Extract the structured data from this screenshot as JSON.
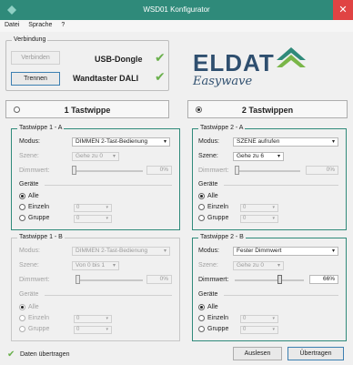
{
  "window": {
    "title": "WSD01 Konfigurator",
    "close_glyph": "✕",
    "app_icon": "diamond-icon",
    "accent": "#2f8a7a"
  },
  "menu": [
    "Datei",
    "Sprache",
    "?"
  ],
  "connection": {
    "legend": "Verbindung",
    "connect_label": "Verbinden",
    "disconnect_label": "Trennen",
    "usb_label": "USB-Dongle",
    "dali_label": "Wandtaster DALI",
    "usb_ok": "✔",
    "dali_ok": "✔"
  },
  "logo": {
    "brand": "ELDAT",
    "sub": "Easywave"
  },
  "mode_tabs": [
    {
      "label": "1 Tastwippe",
      "selected": false
    },
    {
      "label": "2 Tastwippen",
      "selected": true
    }
  ],
  "panels": [
    {
      "legend": "Tastwippe 1 - A",
      "modus_label": "Modus:",
      "modus_value": "DIMMEN 2-Tast-Bedienung",
      "szene_label": "Szene:",
      "szene_value": "Gehe zu 0",
      "dimm_label": "Dimmwert:",
      "dimm_value": "0%",
      "dimm_fraction": 0.0,
      "geraete_label": "Geräte",
      "alle_label": "Alle",
      "einzeln_label": "Einzeln",
      "einzeln_value": "0",
      "gruppe_label": "Gruppe",
      "gruppe_value": "0"
    },
    {
      "legend": "Tastwippe 2 - A",
      "modus_label": "Modus:",
      "modus_value": "SZENE aufrufen",
      "szene_label": "Szene:",
      "szene_value": "Gehe zu 6",
      "dimm_label": "Dimmwert:",
      "dimm_value": "0%",
      "dimm_fraction": 0.0,
      "geraete_label": "Geräte",
      "alle_label": "Alle",
      "einzeln_label": "Einzeln",
      "einzeln_value": "0",
      "gruppe_label": "Gruppe",
      "gruppe_value": "0"
    },
    {
      "legend": "Tastwippe 1 - B",
      "modus_label": "Modus:",
      "modus_value": "DIMMEN 2-Tast-Bedienung",
      "szene_label": "Szene:",
      "szene_value": "Von 0 bis 1",
      "dimm_label": "Dimmwert:",
      "dimm_value": "0%",
      "dimm_fraction": 0.0,
      "geraete_label": "Geräte",
      "alle_label": "Alle",
      "einzeln_label": "Einzeln",
      "einzeln_value": "0",
      "gruppe_label": "Gruppe",
      "gruppe_value": "0"
    },
    {
      "legend": "Tastwippe 2 - B",
      "modus_label": "Modus:",
      "modus_value": "Fester Dimmwert",
      "szene_label": "Szene:",
      "szene_value": "Gehe zu 0",
      "dimm_label": "Dimmwert:",
      "dimm_value": "66%",
      "dimm_fraction": 0.66,
      "geraete_label": "Geräte",
      "alle_label": "Alle",
      "einzeln_label": "Einzeln",
      "einzeln_value": "0",
      "gruppe_label": "Gruppe",
      "gruppe_value": "0"
    }
  ],
  "footer": {
    "status_icon": "✔",
    "status_text": "Daten übertragen",
    "read_label": "Auslesen",
    "transfer_label": "Übertragen"
  }
}
